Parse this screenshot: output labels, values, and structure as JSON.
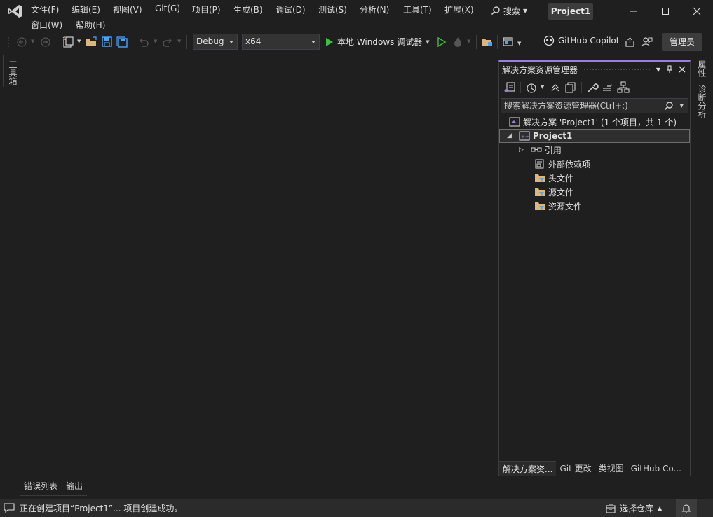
{
  "menu": {
    "items": [
      "文件(F)",
      "编辑(E)",
      "视图(V)",
      "Git(G)",
      "项目(P)",
      "生成(B)",
      "调试(D)",
      "测试(S)",
      "分析(N)",
      "工具(T)",
      "扩展(X)"
    ],
    "row2": [
      "窗口(W)",
      "帮助(H)"
    ]
  },
  "search": {
    "label": "搜索"
  },
  "project_badge": "Project1",
  "toolbar": {
    "config": "Debug",
    "platform": "x64",
    "run_label": "本地 Windows 调试器",
    "copilot_label": "GitHub Copilot",
    "admin_label": "管理员"
  },
  "left_strip": {
    "toolbox": "工具箱"
  },
  "right_strip": {
    "properties": "属性",
    "diagnostics": "诊断分析"
  },
  "solution_explorer": {
    "title": "解决方案资源管理器",
    "search_placeholder": "搜索解决方案资源管理器(Ctrl+;)",
    "solution_label": "解决方案 'Project1' (1 个项目，共 1 个)",
    "project_label": "Project1",
    "nodes": [
      "引用",
      "外部依赖项",
      "头文件",
      "源文件",
      "资源文件"
    ],
    "tabs": [
      "解决方案资...",
      "Git 更改",
      "类视图",
      "GitHub Co..."
    ]
  },
  "bottom_tabs": [
    "错误列表",
    "输出"
  ],
  "status": {
    "message": "正在创建项目“Project1”... 项目创建成功。",
    "repo": "选择仓库"
  },
  "colors": {
    "accent": "#9b7de0",
    "run_green": "#3fbf3f",
    "folder_yellow": "#dcb67a",
    "blue_icon": "#4aa3ff"
  }
}
